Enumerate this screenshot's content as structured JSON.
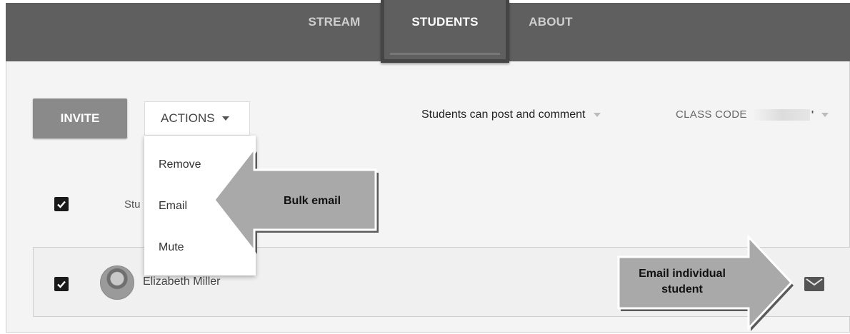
{
  "tabs": [
    {
      "label": "STREAM",
      "active": false
    },
    {
      "label": "STUDENTS",
      "active": true
    },
    {
      "label": "ABOUT",
      "active": false
    }
  ],
  "toolbar": {
    "invite_label": "INVITE",
    "actions_label": "ACTIONS",
    "permission_label": "Students can post and comment",
    "class_code_label": "CLASS CODE",
    "class_code_visible_tail": "'"
  },
  "actions_menu": {
    "items": [
      "Remove",
      "Email",
      "Mute"
    ]
  },
  "list": {
    "header_label": "Stu",
    "students": [
      {
        "name": "Elizabeth Miller",
        "checked": true
      }
    ],
    "select_all_checked": true
  },
  "annotations": {
    "bulk_email": "Bulk email",
    "email_individual_line1": "Email individual",
    "email_individual_line2": "student"
  },
  "icons": {
    "caret": "chevron-down-icon",
    "checkbox": "checkbox-checked-icon",
    "mail": "mail-icon",
    "avatar": "avatar"
  },
  "colors": {
    "topbar": "#5f5f5f",
    "invite_button": "#8a8a8a",
    "callout_fill": "#a9a9a9"
  }
}
